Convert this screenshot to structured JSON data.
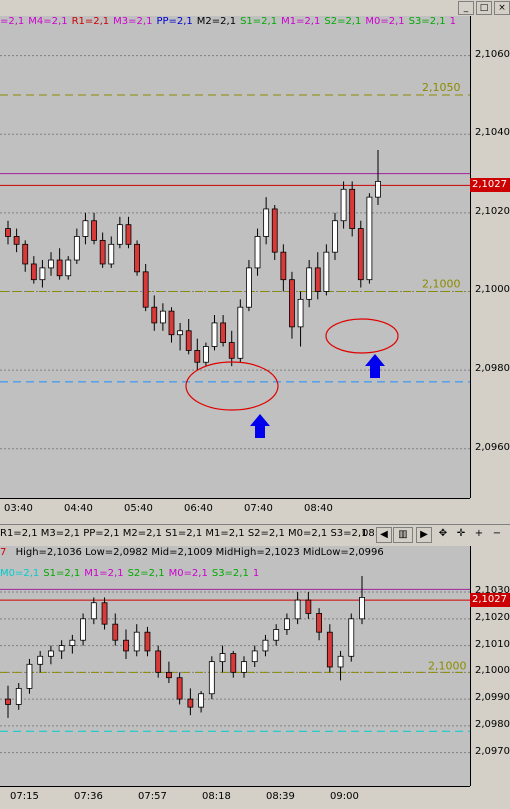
{
  "top_chart": {
    "legend": [
      {
        "text": "=2,1",
        "color": "#cc00cc"
      },
      {
        "text": "M4=2,1",
        "color": "#cc00cc"
      },
      {
        "text": "R1=2,1",
        "color": "#cc0000"
      },
      {
        "text": "M3=2,1",
        "color": "#cc00cc"
      },
      {
        "text": "PP=2,1",
        "color": "#0000cc"
      },
      {
        "text": "M2=2,1",
        "color": "#000000"
      },
      {
        "text": "S1=2,1",
        "color": "#00aa00"
      },
      {
        "text": "M1=2,1",
        "color": "#cc00cc"
      },
      {
        "text": "S2=2,1",
        "color": "#00aa00"
      },
      {
        "text": "M0=2,1",
        "color": "#cc00cc"
      },
      {
        "text": "S3=2,1",
        "color": "#00aa00"
      },
      {
        "text": "1",
        "color": "#cc00cc"
      }
    ],
    "y_ticks": [
      "2,1060",
      "2,1040",
      "2,1020",
      "2,1000",
      "2,0980",
      "2,0960"
    ],
    "x_ticks": [
      "03:40",
      "04:40",
      "05:40",
      "06:40",
      "07:40",
      "08:40"
    ],
    "price_tag": "2,1027",
    "level_labels": [
      {
        "text": "2,1050",
        "value": 2.105
      },
      {
        "text": "2,1000",
        "value": 2.1
      }
    ]
  },
  "status": {
    "text": "R1=2,1 M3=2,1 PP=2,1 M2=2,1 S1=2,1 M1=2,1 S2=2,1 M0=2,1 S3=2,1",
    "suffix": "08:1"
  },
  "bottom_chart": {
    "header_prefix": "7",
    "header": "High=2,1036 Low=2,0982 Mid=2,1009 MidHigh=2,1023 MidLow=2,0996",
    "y_ticks": [
      "2,1030",
      "2,1020",
      "2,1010",
      "2,1000",
      "2,0990",
      "2,0980",
      "2,0970"
    ],
    "x_ticks": [
      "07:15",
      "07:36",
      "07:57",
      "08:18",
      "08:39",
      "09:00"
    ],
    "price_tag": "2,1027",
    "level_label": "2,1000",
    "legend": [
      {
        "text": "M0=2,1",
        "color": "#00cccc"
      },
      {
        "text": "S1=2,1",
        "color": "#00aa00"
      },
      {
        "text": "M1=2,1",
        "color": "#cc00cc"
      },
      {
        "text": "S2=2,1",
        "color": "#00aa00"
      },
      {
        "text": "M0=2,1",
        "color": "#cc00cc"
      },
      {
        "text": "S3=2,1",
        "color": "#00aa00"
      },
      {
        "text": "1",
        "color": "#cc00cc"
      }
    ]
  },
  "chart_data": [
    {
      "type": "candlestick",
      "title": "",
      "ylim": [
        2.095,
        2.1065
      ],
      "y_ticks": [
        2.106,
        2.104,
        2.102,
        2.1,
        2.098,
        2.096
      ],
      "x_ticks": [
        "03:40",
        "04:40",
        "05:40",
        "06:40",
        "07:40",
        "08:40"
      ],
      "levels": [
        {
          "name": "2,1050",
          "value": 2.105,
          "color": "#8b8b00",
          "style": "dashed"
        },
        {
          "name": "2,1000",
          "value": 2.1,
          "color": "#8b8b00",
          "style": "dashed"
        },
        {
          "name": "2,1027",
          "value": 2.1027,
          "color": "#cc0000",
          "style": "solid"
        },
        {
          "name": "",
          "value": 2.103,
          "color": "#a020a0",
          "style": "solid"
        },
        {
          "name": "",
          "value": 2.0977,
          "color": "#1e90ff",
          "style": "dashed"
        }
      ],
      "candles": [
        [
          2.1016,
          2.1018,
          2.1012,
          2.1014
        ],
        [
          2.1014,
          2.1016,
          2.101,
          2.1012
        ],
        [
          2.1012,
          2.1013,
          2.1005,
          2.1007
        ],
        [
          2.1007,
          2.1009,
          2.1002,
          2.1003
        ],
        [
          2.1003,
          2.1008,
          2.1001,
          2.1006
        ],
        [
          2.1006,
          2.101,
          2.1004,
          2.1008
        ],
        [
          2.1008,
          2.1011,
          2.1003,
          2.1004
        ],
        [
          2.1004,
          2.1009,
          2.1003,
          2.1008
        ],
        [
          2.1008,
          2.1016,
          2.1007,
          2.1014
        ],
        [
          2.1014,
          2.102,
          2.1012,
          2.1018
        ],
        [
          2.1018,
          2.102,
          2.1012,
          2.1013
        ],
        [
          2.1013,
          2.1015,
          2.1006,
          2.1007
        ],
        [
          2.1007,
          2.1014,
          2.1006,
          2.1012
        ],
        [
          2.1012,
          2.1019,
          2.1011,
          2.1017
        ],
        [
          2.1017,
          2.1019,
          2.1011,
          2.1012
        ],
        [
          2.1012,
          2.1013,
          2.1004,
          2.1005
        ],
        [
          2.1005,
          2.1007,
          2.0995,
          2.0996
        ],
        [
          2.0996,
          2.0999,
          2.099,
          2.0992
        ],
        [
          2.0992,
          2.0997,
          2.099,
          2.0995
        ],
        [
          2.0995,
          2.0996,
          2.0987,
          2.0989
        ],
        [
          2.0989,
          2.0992,
          2.0985,
          2.099
        ],
        [
          2.099,
          2.0993,
          2.0984,
          2.0985
        ],
        [
          2.0985,
          2.0988,
          2.098,
          2.0982
        ],
        [
          2.0982,
          2.0987,
          2.0981,
          2.0986
        ],
        [
          2.0986,
          2.0994,
          2.0985,
          2.0992
        ],
        [
          2.0992,
          2.0994,
          2.0986,
          2.0987
        ],
        [
          2.0987,
          2.099,
          2.0981,
          2.0983
        ],
        [
          2.0983,
          2.0998,
          2.0982,
          2.0996
        ],
        [
          2.0996,
          2.1008,
          2.0995,
          2.1006
        ],
        [
          2.1006,
          2.1016,
          2.1004,
          2.1014
        ],
        [
          2.1014,
          2.1024,
          2.1012,
          2.1021
        ],
        [
          2.1021,
          2.1022,
          2.1008,
          2.101
        ],
        [
          2.101,
          2.1012,
          2.1,
          2.1003
        ],
        [
          2.1003,
          2.1005,
          2.0988,
          2.0991
        ],
        [
          2.0991,
          2.1,
          2.0986,
          2.0998
        ],
        [
          2.0998,
          2.1008,
          2.0996,
          2.1006
        ],
        [
          2.1006,
          2.101,
          2.0998,
          2.1
        ],
        [
          2.1,
          2.1012,
          2.0999,
          2.101
        ],
        [
          2.101,
          2.102,
          2.1008,
          2.1018
        ],
        [
          2.1018,
          2.1028,
          2.1016,
          2.1026
        ],
        [
          2.1026,
          2.1028,
          2.1014,
          2.1016
        ],
        [
          2.1016,
          2.1018,
          2.1001,
          2.1003
        ],
        [
          2.1003,
          2.1025,
          2.1002,
          2.1024
        ],
        [
          2.1024,
          2.1036,
          2.1022,
          2.1028
        ]
      ],
      "annotations": [
        {
          "type": "ellipse",
          "center": [
            "06:20",
            2.0985
          ]
        },
        {
          "type": "arrow",
          "direction": "up",
          "at": "06:40"
        },
        {
          "type": "ellipse",
          "center": [
            "08:20",
            2.1
          ]
        },
        {
          "type": "arrow",
          "direction": "up",
          "at": "08:40"
        }
      ]
    },
    {
      "type": "candlestick",
      "title": "",
      "header": "High=2,1036 Low=2,0982 Mid=2,1009 MidHigh=2,1023 MidLow=2,0996",
      "ylim": [
        2.0965,
        2.1036
      ],
      "y_ticks": [
        2.103,
        2.102,
        2.101,
        2.1,
        2.099,
        2.098,
        2.097
      ],
      "x_ticks": [
        "07:15",
        "07:36",
        "07:57",
        "08:18",
        "08:39",
        "09:00"
      ],
      "levels": [
        {
          "name": "2,1000",
          "value": 2.1,
          "color": "#8b8b00",
          "style": "dashed"
        },
        {
          "name": "2,1027",
          "value": 2.1027,
          "color": "#cc0000",
          "style": "solid"
        },
        {
          "name": "",
          "value": 2.1031,
          "color": "#a020a0",
          "style": "solid"
        },
        {
          "name": "",
          "value": 2.0978,
          "color": "#00cccc",
          "style": "dashed"
        }
      ],
      "candles": [
        [
          2.099,
          2.0995,
          2.0983,
          2.0988
        ],
        [
          2.0988,
          2.0996,
          2.0986,
          2.0994
        ],
        [
          2.0994,
          2.1005,
          2.0992,
          2.1003
        ],
        [
          2.1003,
          2.1008,
          2.1,
          2.1006
        ],
        [
          2.1006,
          2.101,
          2.1003,
          2.1008
        ],
        [
          2.1008,
          2.1012,
          2.1005,
          2.101
        ],
        [
          2.101,
          2.1014,
          2.1007,
          2.1012
        ],
        [
          2.1012,
          2.1022,
          2.101,
          2.102
        ],
        [
          2.102,
          2.1028,
          2.1018,
          2.1026
        ],
        [
          2.1026,
          2.1028,
          2.1016,
          2.1018
        ],
        [
          2.1018,
          2.1022,
          2.101,
          2.1012
        ],
        [
          2.1012,
          2.1016,
          2.1005,
          2.1008
        ],
        [
          2.1008,
          2.1018,
          2.1006,
          2.1015
        ],
        [
          2.1015,
          2.1017,
          2.1006,
          2.1008
        ],
        [
          2.1008,
          2.101,
          2.0998,
          2.1
        ],
        [
          2.1,
          2.1004,
          2.0996,
          2.0998
        ],
        [
          2.0998,
          2.1,
          2.0988,
          2.099
        ],
        [
          2.099,
          2.0994,
          2.0984,
          2.0987
        ],
        [
          2.0987,
          2.0993,
          2.0985,
          2.0992
        ],
        [
          2.0992,
          2.1006,
          2.099,
          2.1004
        ],
        [
          2.1004,
          2.101,
          2.1,
          2.1007
        ],
        [
          2.1007,
          2.1008,
          2.0998,
          2.1
        ],
        [
          2.1,
          2.1006,
          2.0998,
          2.1004
        ],
        [
          2.1004,
          2.101,
          2.1002,
          2.1008
        ],
        [
          2.1008,
          2.1014,
          2.1006,
          2.1012
        ],
        [
          2.1012,
          2.1018,
          2.101,
          2.1016
        ],
        [
          2.1016,
          2.1022,
          2.1014,
          2.102
        ],
        [
          2.102,
          2.103,
          2.1018,
          2.1027
        ],
        [
          2.1027,
          2.103,
          2.102,
          2.1022
        ],
        [
          2.1022,
          2.1024,
          2.1012,
          2.1015
        ],
        [
          2.1015,
          2.1018,
          2.1,
          2.1002
        ],
        [
          2.1002,
          2.1008,
          2.0997,
          2.1006
        ],
        [
          2.1006,
          2.1022,
          2.1004,
          2.102
        ],
        [
          2.102,
          2.1036,
          2.1018,
          2.1028
        ]
      ]
    }
  ]
}
